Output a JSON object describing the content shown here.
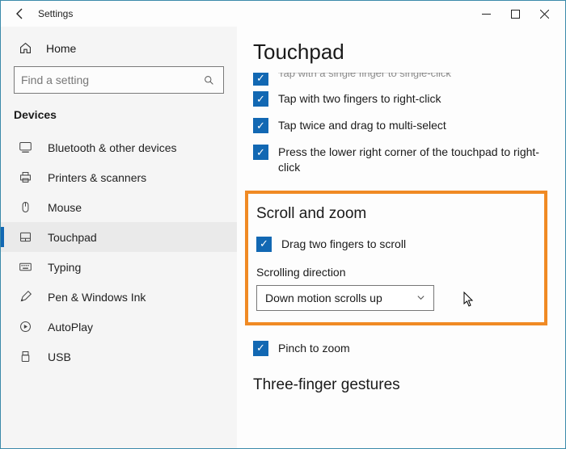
{
  "window": {
    "title": "Settings"
  },
  "sidebar": {
    "home": "Home",
    "search_placeholder": "Find a setting",
    "section": "Devices",
    "items": [
      {
        "label": "Bluetooth & other devices"
      },
      {
        "label": "Printers & scanners"
      },
      {
        "label": "Mouse"
      },
      {
        "label": "Touchpad"
      },
      {
        "label": "Typing"
      },
      {
        "label": "Pen & Windows Ink"
      },
      {
        "label": "AutoPlay"
      },
      {
        "label": "USB"
      }
    ]
  },
  "page": {
    "title": "Touchpad",
    "taps": {
      "truncated": "Tap with a single finger to single-click",
      "two_finger": "Tap with two fingers to right-click",
      "tap_drag": "Tap twice and drag to multi-select",
      "lower_right": "Press the lower right corner of the touchpad to right-click"
    },
    "scroll_zoom": {
      "heading": "Scroll and zoom",
      "drag_two": "Drag two fingers to scroll",
      "direction_label": "Scrolling direction",
      "direction_value": "Down motion scrolls up",
      "pinch": "Pinch to zoom"
    },
    "three_finger": {
      "heading": "Three-finger gestures"
    }
  }
}
